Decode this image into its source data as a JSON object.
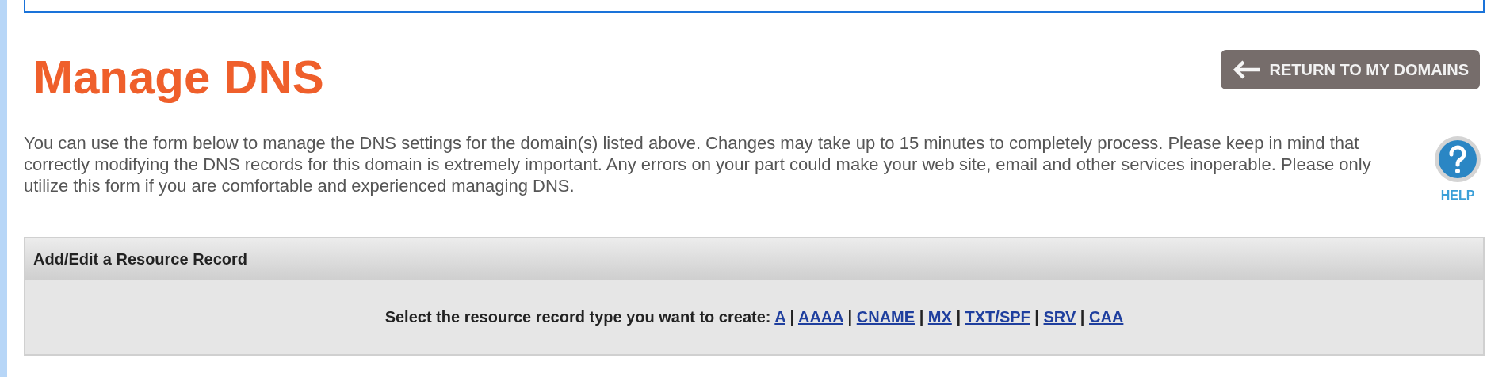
{
  "title": "Manage DNS",
  "return_button": {
    "label": "RETURN TO MY DOMAINS"
  },
  "intro": "You can use the form below to manage the DNS settings for the domain(s) listed above. Changes may take up to 15 minutes to completely process. Please keep in mind that correctly modifying the DNS records for this domain is extremely important. Any errors on your part could make your web site, email and other services inoperable. Please only utilize this form if you are comfortable and experienced managing DNS.",
  "help": {
    "label": "HELP"
  },
  "panel": {
    "title": "Add/Edit a Resource Record",
    "prompt": "Select the resource record type you want to create:",
    "separator": "|",
    "record_types": [
      "A",
      "AAAA",
      "CNAME",
      "MX",
      "TXT/SPF",
      "SRV",
      "CAA"
    ]
  }
}
